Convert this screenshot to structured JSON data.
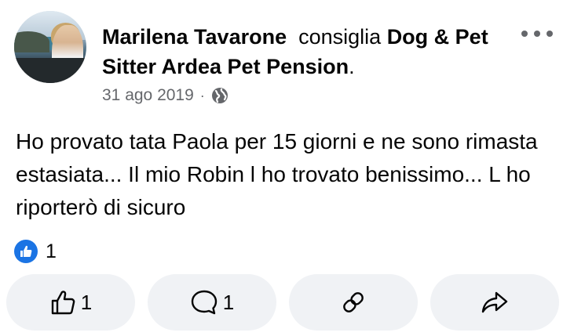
{
  "post": {
    "author": "Marilena Tavarone",
    "verb": "consiglia",
    "page_name": "Dog & Pet Sitter Ardea Pet Pension",
    "period": ".",
    "date": "31 ago 2019",
    "separator": "·",
    "privacy_icon": "globe-icon",
    "text": "Ho provato tata Paola per 15 giorni e ne sono rimasta estasiata... Il mio Robin l ho trovato benissimo... L ho riporterò di sicuro"
  },
  "reactions": {
    "icon": "like-reaction-icon",
    "count": "1"
  },
  "actions": {
    "like_count": "1",
    "comment_count": "1",
    "share_icon": "link-icon",
    "forward_icon": "share-arrow-icon"
  },
  "colors": {
    "accent": "#1b74e4",
    "secondary_text": "#65676b",
    "button_bg": "#f0f2f5"
  }
}
